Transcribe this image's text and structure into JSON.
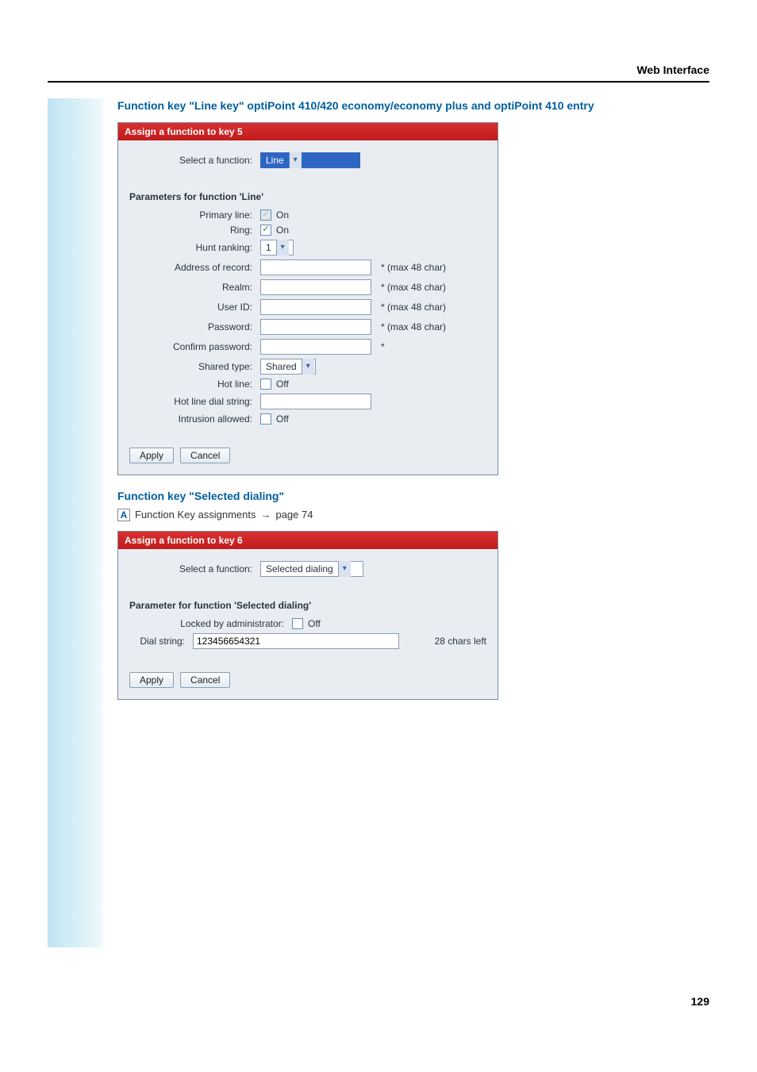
{
  "header": {
    "section": "Web Interface"
  },
  "section1": {
    "heading": "Function key \"Line key\" optiPoint 410/420 economy/economy plus and optiPoint 410 entry"
  },
  "panel1": {
    "title": "Assign a function to key 5",
    "select_function_label": "Select a function:",
    "select_function_value": "Line",
    "params_heading": "Parameters for function 'Line'",
    "rows": {
      "primary_line": {
        "label": "Primary line:",
        "checked": true,
        "on": "On",
        "disabled": true
      },
      "ring": {
        "label": "Ring:",
        "checked": true,
        "on": "On"
      },
      "hunt_ranking": {
        "label": "Hunt ranking:",
        "value": "1"
      },
      "address_of_record": {
        "label": "Address of record:",
        "value": "",
        "note": "* (max 48 char)"
      },
      "realm": {
        "label": "Realm:",
        "value": "",
        "note": "* (max 48 char)"
      },
      "user_id": {
        "label": "User ID:",
        "value": "",
        "note": "* (max 48 char)"
      },
      "password": {
        "label": "Password:",
        "value": "",
        "note": "* (max 48 char)"
      },
      "confirm_password": {
        "label": "Confirm password:",
        "value": "",
        "note": "*"
      },
      "shared_type": {
        "label": "Shared type:",
        "value": "Shared"
      },
      "hot_line": {
        "label": "Hot line:",
        "checked": false,
        "off": "Off"
      },
      "hot_line_dial_string": {
        "label": "Hot line dial string:",
        "value": ""
      },
      "intrusion_allowed": {
        "label": "Intrusion allowed:",
        "checked": false,
        "off": "Off"
      }
    },
    "buttons": {
      "apply": "Apply",
      "cancel": "Cancel"
    }
  },
  "section2": {
    "heading": "Function key \"Selected dialing\"",
    "ref_badge": "A",
    "ref_text": "Function Key assignments",
    "ref_arrow": "→",
    "ref_page": "page 74"
  },
  "panel2": {
    "title": "Assign a function to key 6",
    "select_function_label": "Select a function:",
    "select_function_value": "Selected dialing",
    "params_heading": "Parameter for function 'Selected dialing'",
    "locked_label": "Locked by administrator:",
    "locked_checked": false,
    "locked_off": "Off",
    "dial_string_label": "Dial string:",
    "dial_string_value": "123456654321",
    "chars_left": "28 chars left",
    "buttons": {
      "apply": "Apply",
      "cancel": "Cancel"
    }
  },
  "footer": {
    "page_number": "129"
  }
}
